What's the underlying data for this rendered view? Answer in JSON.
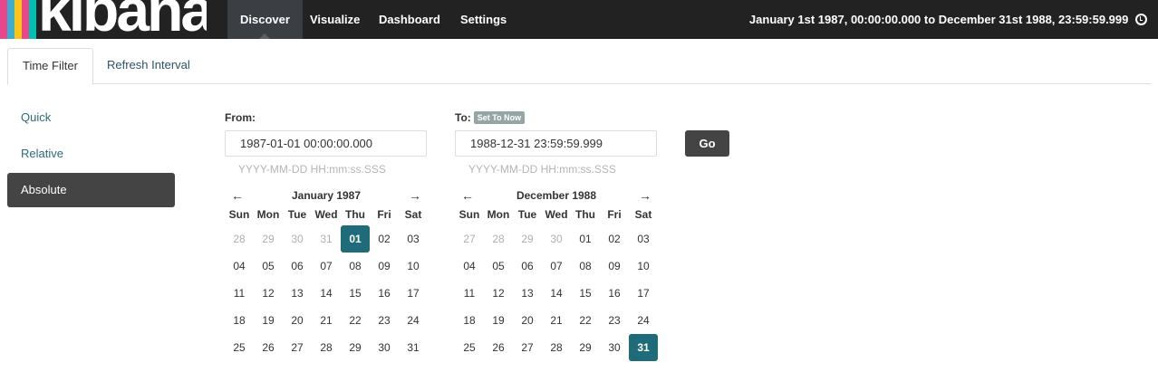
{
  "logo": {
    "text": "kibana",
    "stripe_colors": [
      "#e8488b",
      "#3caed2",
      "#fec514",
      "#e8488b",
      "#00bfb3"
    ]
  },
  "nav": {
    "tabs": [
      {
        "label": "Discover",
        "active": true
      },
      {
        "label": "Visualize",
        "active": false
      },
      {
        "label": "Dashboard",
        "active": false
      },
      {
        "label": "Settings",
        "active": false
      }
    ],
    "time_range": "January 1st 1987, 00:00:00.000 to December 31st 1988, 23:59:59.999",
    "time_icon": "clock-icon"
  },
  "subtabs": {
    "time_filter": "Time Filter",
    "refresh_interval": "Refresh Interval"
  },
  "mode_menu": {
    "quick": "Quick",
    "relative": "Relative",
    "absolute": "Absolute"
  },
  "from": {
    "label": "From:",
    "value": "1987-01-01 00:00:00.000",
    "hint": "YYYY-MM-DD HH:mm:ss.SSS",
    "calendar": {
      "prev": "←",
      "next": "→",
      "title": "January 1987",
      "weekdays": [
        "Sun",
        "Mon",
        "Tue",
        "Wed",
        "Thu",
        "Fri",
        "Sat"
      ],
      "days": [
        {
          "d": "28",
          "muted": true
        },
        {
          "d": "29",
          "muted": true
        },
        {
          "d": "30",
          "muted": true
        },
        {
          "d": "31",
          "muted": true
        },
        {
          "d": "01",
          "sel": true
        },
        {
          "d": "02"
        },
        {
          "d": "03"
        },
        {
          "d": "04"
        },
        {
          "d": "05"
        },
        {
          "d": "06"
        },
        {
          "d": "07"
        },
        {
          "d": "08"
        },
        {
          "d": "09"
        },
        {
          "d": "10"
        },
        {
          "d": "11"
        },
        {
          "d": "12"
        },
        {
          "d": "13"
        },
        {
          "d": "14"
        },
        {
          "d": "15"
        },
        {
          "d": "16"
        },
        {
          "d": "17"
        },
        {
          "d": "18"
        },
        {
          "d": "19"
        },
        {
          "d": "20"
        },
        {
          "d": "21"
        },
        {
          "d": "22"
        },
        {
          "d": "23"
        },
        {
          "d": "24"
        },
        {
          "d": "25"
        },
        {
          "d": "26"
        },
        {
          "d": "27"
        },
        {
          "d": "28"
        },
        {
          "d": "29"
        },
        {
          "d": "30"
        },
        {
          "d": "31"
        }
      ]
    }
  },
  "to": {
    "label": "To:",
    "set_to_now": "Set To Now",
    "value": "1988-12-31 23:59:59.999",
    "hint": "YYYY-MM-DD HH:mm:ss.SSS",
    "calendar": {
      "prev": "←",
      "next": "→",
      "title": "December 1988",
      "weekdays": [
        "Sun",
        "Mon",
        "Tue",
        "Wed",
        "Thu",
        "Fri",
        "Sat"
      ],
      "days": [
        {
          "d": "27",
          "muted": true
        },
        {
          "d": "28",
          "muted": true
        },
        {
          "d": "29",
          "muted": true
        },
        {
          "d": "30",
          "muted": true
        },
        {
          "d": "01"
        },
        {
          "d": "02"
        },
        {
          "d": "03"
        },
        {
          "d": "04"
        },
        {
          "d": "05"
        },
        {
          "d": "06"
        },
        {
          "d": "07"
        },
        {
          "d": "08"
        },
        {
          "d": "09"
        },
        {
          "d": "10"
        },
        {
          "d": "11"
        },
        {
          "d": "12"
        },
        {
          "d": "13"
        },
        {
          "d": "14"
        },
        {
          "d": "15"
        },
        {
          "d": "16"
        },
        {
          "d": "17"
        },
        {
          "d": "18"
        },
        {
          "d": "19"
        },
        {
          "d": "20"
        },
        {
          "d": "21"
        },
        {
          "d": "22"
        },
        {
          "d": "23"
        },
        {
          "d": "24"
        },
        {
          "d": "25"
        },
        {
          "d": "26"
        },
        {
          "d": "27"
        },
        {
          "d": "28"
        },
        {
          "d": "29"
        },
        {
          "d": "30"
        },
        {
          "d": "31",
          "sel": true
        }
      ]
    }
  },
  "go_label": "Go"
}
